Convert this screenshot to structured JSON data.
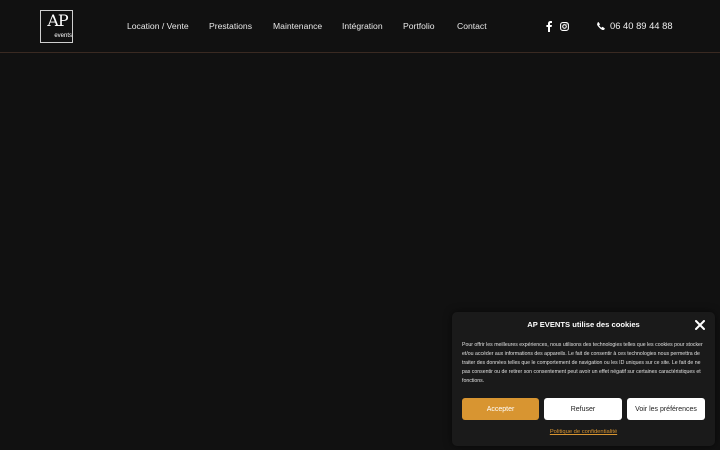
{
  "logo": {
    "mark": "AP",
    "sub": "events"
  },
  "nav": [
    {
      "label": "Location / Vente"
    },
    {
      "label": "Prestations"
    },
    {
      "label": "Maintenance"
    },
    {
      "label": "Intégration"
    },
    {
      "label": "Portfolio"
    },
    {
      "label": "Contact"
    }
  ],
  "contact": {
    "phone": "06 40 89 44 88"
  },
  "icons": {
    "facebook": "facebook-icon",
    "instagram": "instagram-icon",
    "phone": "phone-icon",
    "close": "close-icon"
  },
  "colors": {
    "background": "#111111",
    "accent": "#d89531",
    "panel": "#1a1a1a"
  },
  "cookie": {
    "title": "AP EVENTS utilise des cookies",
    "text": "Pour offrir les meilleures expériences, nous utilisons des technologies telles que les cookies pour stocker et/ou accéder aux informations des appareils. Le fait de consentir à ces technologies nous permettra de traiter des données telles que le comportement de navigation ou les ID uniques sur ce site. Le fait de ne pas consentir ou de retirer son consentement peut avoir un effet négatif sur certaines caractéristiques et fonctions.",
    "accept_label": "Accepter",
    "refuse_label": "Refuser",
    "prefs_label": "Voir les préférences",
    "policy_link": "Politique de confidentialité"
  }
}
